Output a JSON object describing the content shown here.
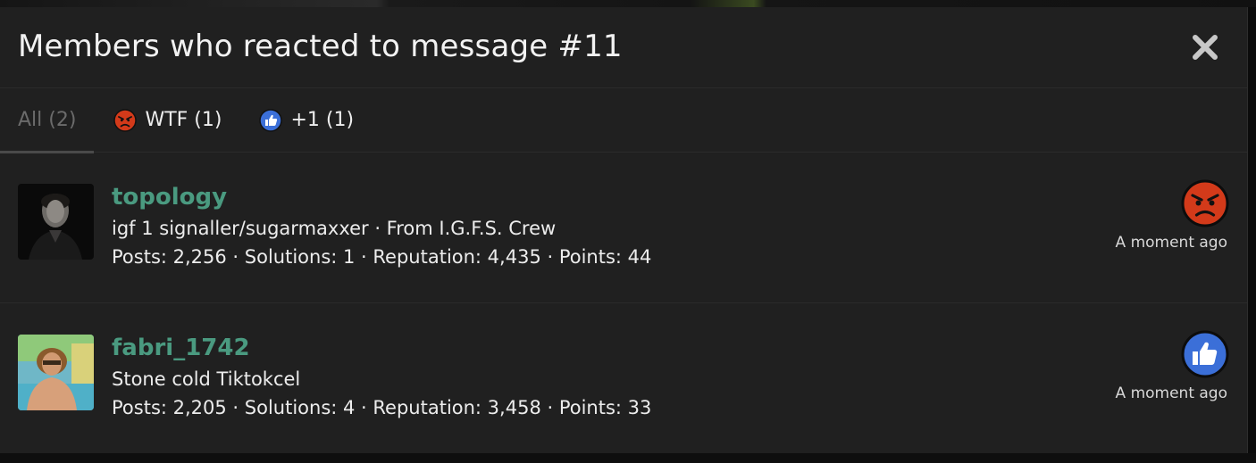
{
  "dialog": {
    "title": "Members who reacted to message #11",
    "close_icon": "close-icon"
  },
  "tabs": [
    {
      "label": "All (2)",
      "active": true
    },
    {
      "label": "WTF (1)",
      "icon": "angry-face-icon"
    },
    {
      "label": "+1 (1)",
      "icon": "thumbs-up-icon"
    }
  ],
  "members": [
    {
      "username": "topology",
      "title": "igf 1 signaller/sugarmaxxer · From I.G.F.S. Crew",
      "stats": "Posts: 2,256 · Solutions: 1 · Reputation: 4,435 · Points: 44",
      "reaction": "angry-face-icon",
      "time": "A moment ago"
    },
    {
      "username": "fabri_1742",
      "title": "Stone cold Tiktokcel",
      "stats": "Posts: 2,205 · Solutions: 4 · Reputation: 3,458 · Points: 33",
      "reaction": "thumbs-up-icon",
      "time": "A moment ago"
    }
  ],
  "colors": {
    "username": "#4a9a80",
    "angry_red": "#d33a1a",
    "like_blue": "#3b6fd8"
  }
}
